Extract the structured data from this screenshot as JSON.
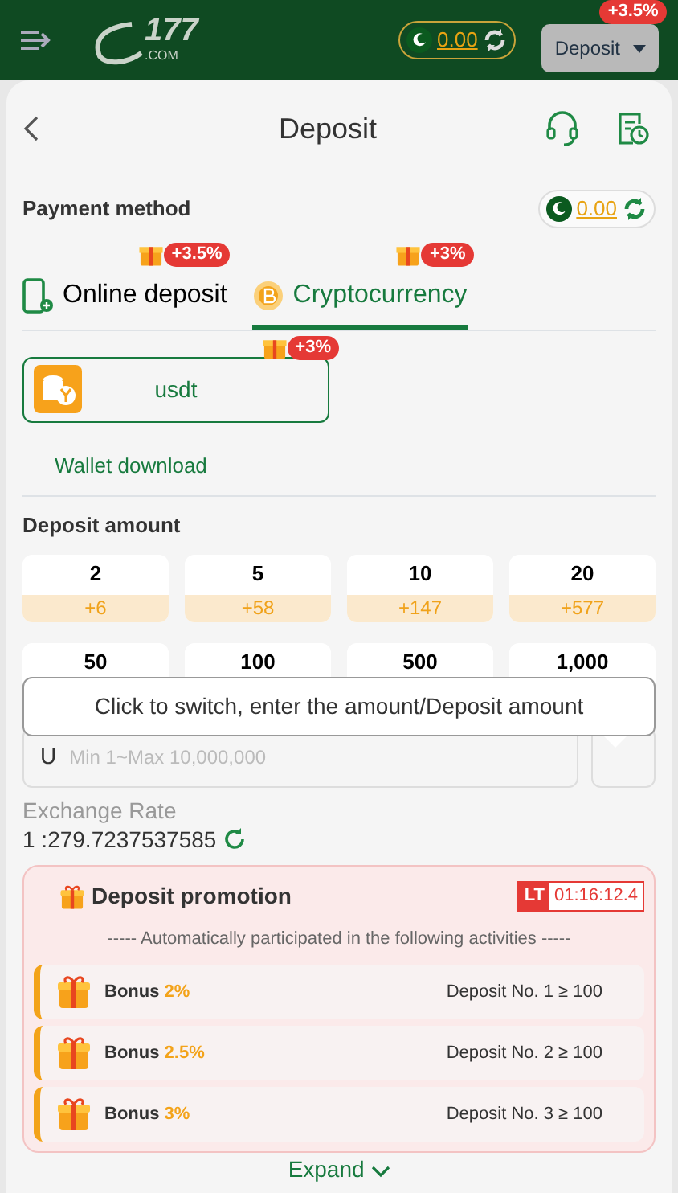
{
  "header": {
    "logo_number": "177",
    "logo_suffix": ".COM",
    "balance": "0.00",
    "deposit_button": "Deposit",
    "deposit_badge": "+3.5%"
  },
  "title": "Deposit",
  "payment_method": {
    "label": "Payment method",
    "balance": "0.00"
  },
  "tabs": [
    {
      "label": "Online deposit",
      "badge": "+3.5%",
      "kind": "phone",
      "selected": false
    },
    {
      "label": "Cryptocurrency",
      "badge": "+3%",
      "kind": "coin",
      "selected": true
    }
  ],
  "channels": [
    {
      "label": "usdt",
      "badge": "+3%",
      "selected": true
    }
  ],
  "wallet_link": "Wallet download",
  "amount": {
    "label": "Deposit amount",
    "options": [
      {
        "value": "2",
        "bonus": "+6"
      },
      {
        "value": "5",
        "bonus": "+58"
      },
      {
        "value": "10",
        "bonus": "+147"
      },
      {
        "value": "20",
        "bonus": "+577"
      },
      {
        "value": "50"
      },
      {
        "value": "100"
      },
      {
        "value": "500"
      },
      {
        "value": "1,000"
      }
    ]
  },
  "tooltip": "Click to switch, enter the amount/Deposit amount",
  "input": {
    "prefix": "U",
    "placeholder": "Min 1~Max 10,000,000"
  },
  "exchange": {
    "label": "Exchange Rate",
    "value": "1 :279.7237537585"
  },
  "promotion": {
    "title": "Deposit promotion",
    "tag": "LT",
    "timer": "01:16:12.4",
    "subtitle": "----- Automatically participated in the following activities -----",
    "items": [
      {
        "label": "Bonus",
        "rate": "2%",
        "condition": "Deposit No. 1 ≥ 100"
      },
      {
        "label": "Bonus",
        "rate": "2.5%",
        "condition": "Deposit No. 2 ≥ 100"
      },
      {
        "label": "Bonus",
        "rate": "3%",
        "condition": "Deposit No. 3 ≥ 100"
      }
    ]
  },
  "expand": "Expand"
}
